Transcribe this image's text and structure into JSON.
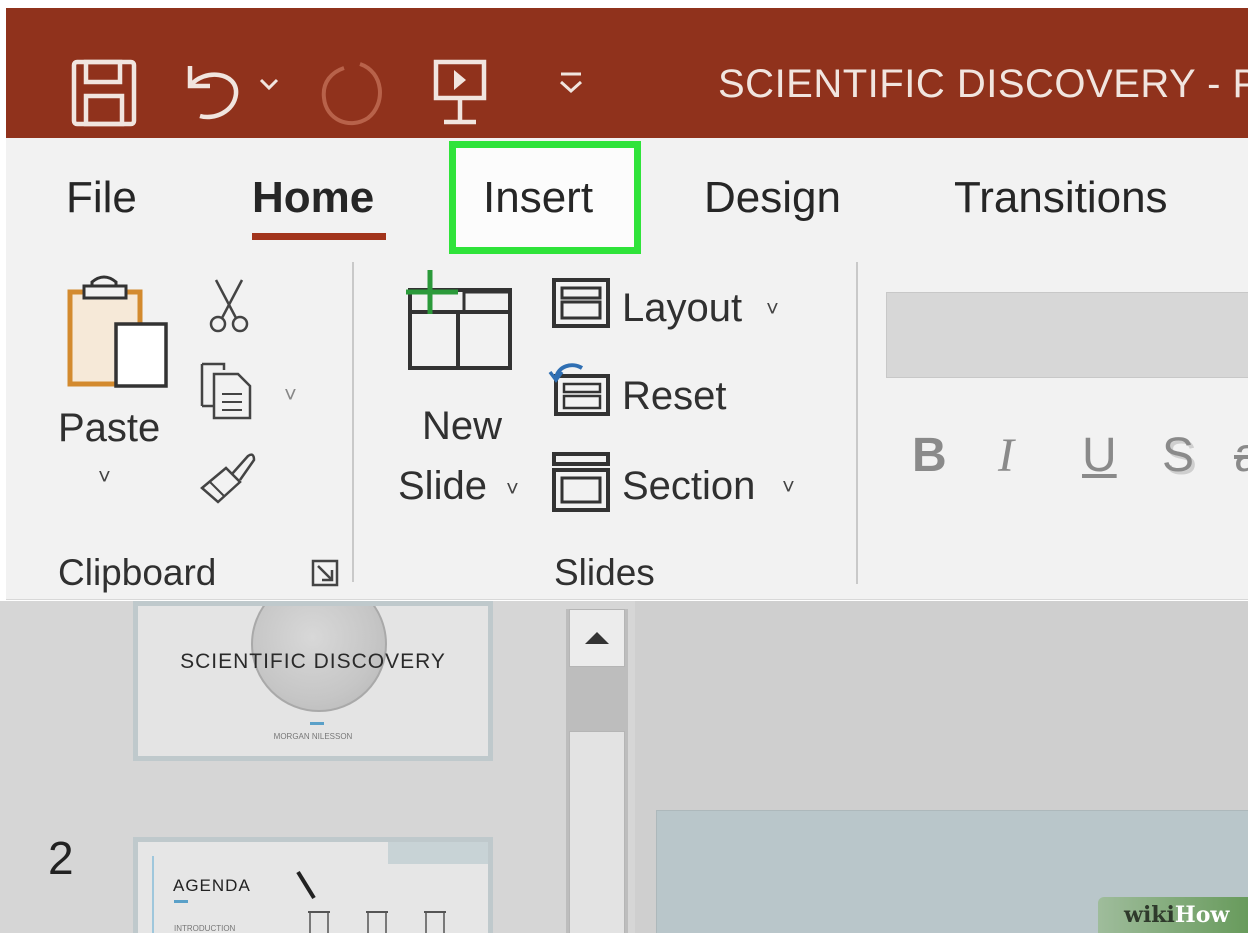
{
  "colors": {
    "title_bar": "#90321c",
    "ribbon_bg": "#f2f2f2",
    "active_tab_underline": "#a2341c",
    "insert_highlight": "#2fe33a",
    "workspace_bg": "#d6d6d6"
  },
  "titlebar": {
    "document_title": "SCIENTIFIC DISCOVERY  -  P",
    "quick_access": [
      {
        "icon": "save-icon"
      },
      {
        "icon": "undo-icon"
      },
      {
        "icon": "undo-dropdown-chevron-icon"
      },
      {
        "icon": "redo-icon",
        "disabled": true
      },
      {
        "icon": "start-slideshow-icon"
      },
      {
        "icon": "customize-quick-access-icon"
      }
    ]
  },
  "tabs": {
    "file": "File",
    "home": "Home",
    "insert": "Insert",
    "design": "Design",
    "transitions": "Transitions",
    "active": "Home",
    "highlighted": "Insert"
  },
  "ribbon": {
    "clipboard": {
      "paste_label": "Paste",
      "paste_chevron": "˅",
      "group_label": "Clipboard",
      "icons": [
        "paste-icon",
        "cut-icon",
        "copy-icon",
        "format-painter-icon",
        "dialog-launcher-icon"
      ]
    },
    "slides": {
      "new_slide_line1": "New",
      "new_slide_line2": "Slide",
      "chevron": "˅",
      "layout_label": "Layout",
      "reset_label": "Reset",
      "section_label": "Section",
      "group_label": "Slides",
      "icons": [
        "new-slide-icon",
        "layout-icon",
        "reset-icon",
        "section-icon"
      ]
    },
    "font": {
      "bold": "B",
      "italic": "I",
      "underline": "U",
      "shadow": "S",
      "strikethrough": "a"
    }
  },
  "slides_pane": {
    "slide1": {
      "title": "SCIENTIFIC DISCOVERY",
      "subtitle": "MORGAN NILESSON"
    },
    "slide2": {
      "number": "2",
      "title": "AGENDA",
      "subtitle": "INTRODUCTION"
    }
  },
  "watermark": {
    "wiki": "wiki",
    "how": "How"
  }
}
